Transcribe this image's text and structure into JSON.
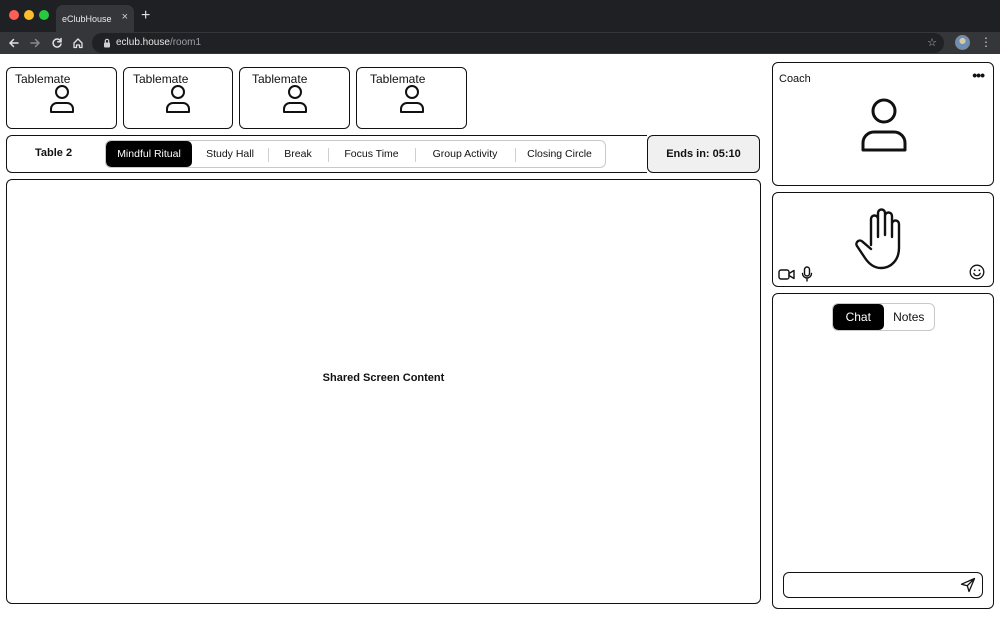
{
  "browser": {
    "tab_title": "eClubHouse",
    "tab_close": "×",
    "new_tab": "+",
    "url_host": "eclub.house",
    "url_path": "/room1",
    "star": "☆",
    "menu": "⋮"
  },
  "tablemates": [
    {
      "label": "Tablemate"
    },
    {
      "label": "Tablemate"
    },
    {
      "label": "Tablemate"
    },
    {
      "label": "Tablemate"
    }
  ],
  "session": {
    "table_name": "Table 2",
    "segments": [
      {
        "label": "Mindful Ritual",
        "active": true
      },
      {
        "label": "Study Hall",
        "active": false
      },
      {
        "label": "Break",
        "active": false
      },
      {
        "label": "Focus Time",
        "active": false
      },
      {
        "label": "Group Activity",
        "active": false
      },
      {
        "label": "Closing Circle",
        "active": false
      }
    ],
    "timer": "Ends in: 05:10"
  },
  "main": {
    "shared_screen": "Shared Screen Content"
  },
  "coach": {
    "label": "Coach",
    "more": "•••"
  },
  "self_view": {
    "icons": [
      "hand-raise-icon",
      "video-camera-icon",
      "microphone-icon",
      "emoji-icon"
    ]
  },
  "panel": {
    "tabs": [
      {
        "label": "Chat",
        "active": true
      },
      {
        "label": "Notes",
        "active": false
      }
    ],
    "input_placeholder": ""
  }
}
